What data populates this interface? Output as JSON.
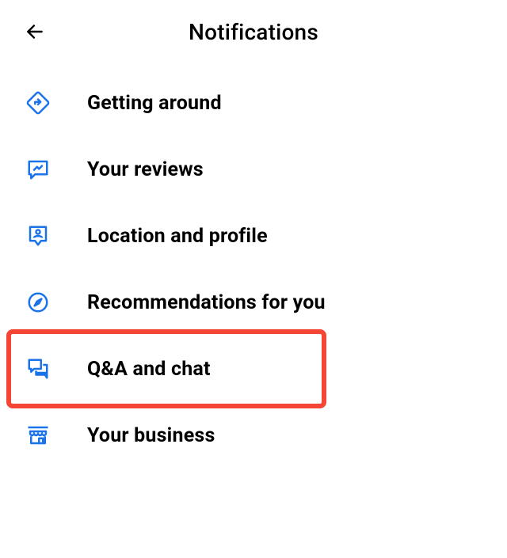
{
  "header": {
    "title": "Notifications"
  },
  "items": [
    {
      "icon": "directions",
      "label": "Getting around",
      "highlighted": false
    },
    {
      "icon": "review",
      "label": "Your reviews",
      "highlighted": false
    },
    {
      "icon": "profile-pin",
      "label": "Location and profile",
      "highlighted": false
    },
    {
      "icon": "compass",
      "label": "Recommendations for you",
      "highlighted": false
    },
    {
      "icon": "chat",
      "label": "Q&A and chat",
      "highlighted": true
    },
    {
      "icon": "storefront",
      "label": "Your business",
      "highlighted": false
    }
  ],
  "colors": {
    "icon": "#1a73e8",
    "highlight": "#f44535"
  }
}
